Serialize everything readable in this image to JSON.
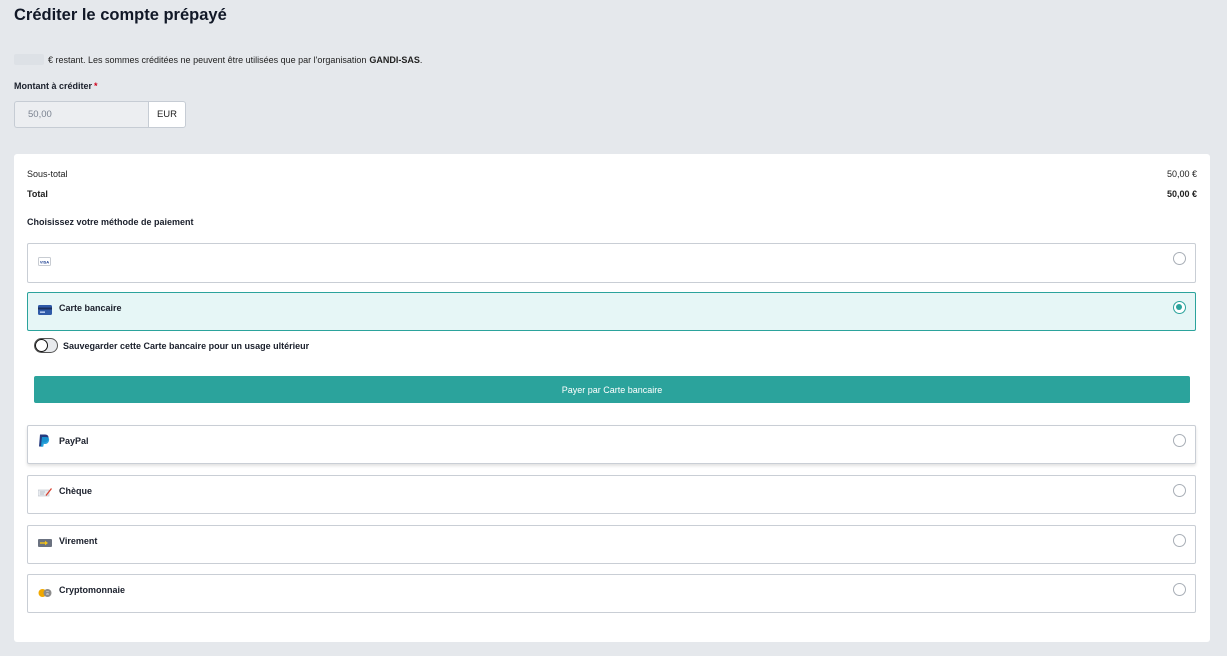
{
  "page": {
    "title": "Créditer le compte prépayé"
  },
  "balance": {
    "text": "€ restant. Les sommes créditées ne peuvent être utilisées que par l'organisation",
    "organisation": "GANDI-SAS",
    "suffix": "."
  },
  "amount": {
    "label": "Montant à créditer",
    "required_mark": "*",
    "value": "50,00",
    "unit": "EUR"
  },
  "summary": {
    "subtotal_label": "Sous-total",
    "subtotal_value": "50,00 €",
    "total_label": "Total",
    "total_value": "50,00 €"
  },
  "payment": {
    "heading": "Choisissez votre méthode de paiement",
    "methods": [
      {
        "label": "",
        "icon": "visa-card-icon",
        "selected": false
      },
      {
        "label": "Carte bancaire",
        "icon": "credit-card-icon",
        "selected": true
      },
      {
        "label": "PayPal",
        "icon": "paypal-icon",
        "selected": false
      },
      {
        "label": "Chèque",
        "icon": "cheque-icon",
        "selected": false
      },
      {
        "label": "Virement",
        "icon": "transfer-icon",
        "selected": false
      },
      {
        "label": "Cryptomonnaie",
        "icon": "crypto-icon",
        "selected": false
      }
    ],
    "save_card_label": "Sauvegarder cette Carte bancaire pour un usage ultérieur",
    "pay_button_label": "Payer par Carte bancaire"
  },
  "colors": {
    "accent": "#2ba39c",
    "selected_bg": "#e6f6f6",
    "page_bg": "#e5e8ec"
  }
}
